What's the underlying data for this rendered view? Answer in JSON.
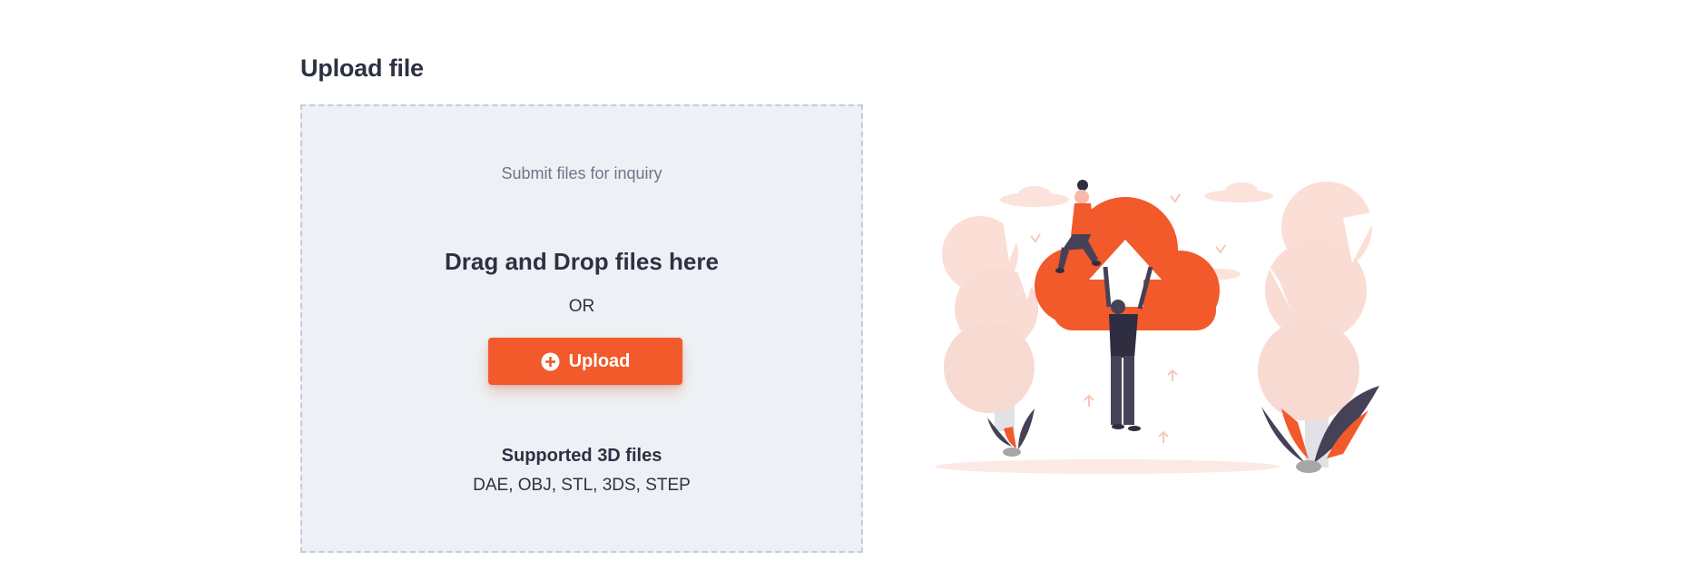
{
  "page": {
    "title": "Upload file"
  },
  "dropzone": {
    "subtitle": "Submit files for inquiry",
    "drag_text": "Drag and Drop files here",
    "or_text": "OR",
    "upload_label": "Upload",
    "supported_title": "Supported 3D files",
    "supported_formats": "DAE, OBJ, STL, 3DS, STEP"
  },
  "colors": {
    "accent": "#f2592b",
    "dropzone_bg": "#edf1f5",
    "dropzone_border": "#c4ccd8",
    "text_dark": "#2d3142",
    "text_muted": "#6f7688"
  },
  "icons": {
    "upload_button_icon": "plus-circle-icon",
    "illustration": "cloud-upload-illustration"
  }
}
